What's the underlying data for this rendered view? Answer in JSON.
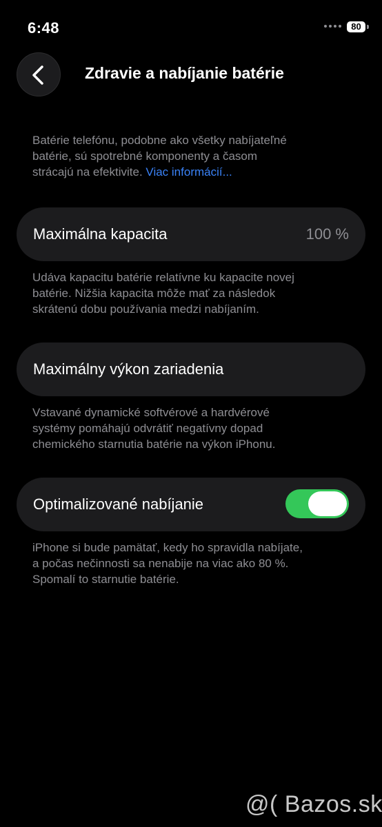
{
  "status_bar": {
    "time": "6:48",
    "battery_level": "80"
  },
  "header": {
    "title": "Zdravie a nabíjanie batérie",
    "back_icon": "chevron-left-icon"
  },
  "intro": {
    "lines": [
      "Batérie telefónu, podobne ako všetky nabíjateľné",
      "batérie, sú spotrebné komponenty a časom"
    ],
    "last_line": "strácajú na efektivite. ",
    "link": "Viac informácií..."
  },
  "capacity": {
    "label": "Maximálna kapacita",
    "value": "100 %",
    "description": [
      "Udáva kapacitu batérie relatívne ku kapacite novej",
      "batérie. Nižšia kapacita môže mať za následok",
      "skrátenú dobu používania medzi nabíjaním."
    ]
  },
  "performance": {
    "label": "Maximálny výkon zariadenia",
    "description": [
      "Vstavané dynamické softvérové a hardvérové",
      "systémy pomáhajú odvrátiť negatívny dopad",
      "chemického starnutia batérie na výkon iPhonu."
    ]
  },
  "optimized_charging": {
    "label": "Optimalizované nabíjanie",
    "enabled": true,
    "description": [
      "iPhone si bude pamätať, kedy ho spravidla nabíjate,",
      "a počas nečinnosti sa nenabije na viac ako 80 %.",
      "Spomalí to starnutie batérie."
    ]
  },
  "colors": {
    "accent_green": "#34c759",
    "link_blue": "#3a82f7",
    "card_bg": "#1c1c1e",
    "secondary_text": "#8e8e93"
  },
  "watermark": "@( Bazos.sk"
}
